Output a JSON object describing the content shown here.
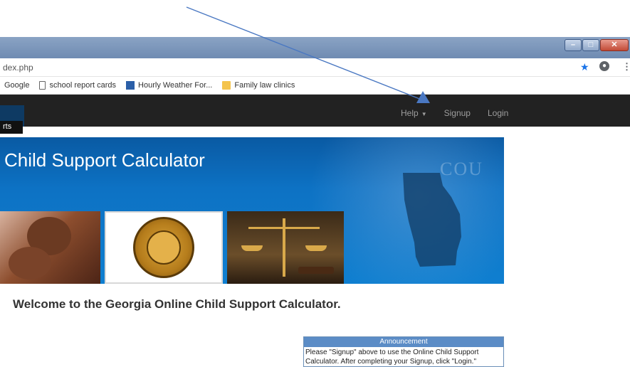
{
  "browser": {
    "url": "dex.php",
    "bookmarks": [
      {
        "label": "Google",
        "icon": "google-icon"
      },
      {
        "label": "school report cards",
        "icon": "page-icon"
      },
      {
        "label": "Hourly Weather For...",
        "icon": "weather-icon"
      },
      {
        "label": "Family law clinics",
        "icon": "folder-icon"
      }
    ]
  },
  "navbar": {
    "help": "Help",
    "signup": "Signup",
    "login": "Login",
    "crumb": "rts"
  },
  "banner": {
    "title": "Child Support Calculator",
    "background_text": "COU"
  },
  "main": {
    "welcome": "Welcome to the Georgia Online Child Support Calculator.",
    "announcement": {
      "heading": "Announcement",
      "line1": "Please \"Signup\" above to use the Online Child Support",
      "line2": "Calculator. After completing your Signup, click \"Login.\""
    }
  },
  "colors": {
    "navbar": "#222222",
    "banner": "#0d72c4",
    "annotation_arrow": "#4a78c2",
    "announcement_header": "#5b8cc6"
  }
}
